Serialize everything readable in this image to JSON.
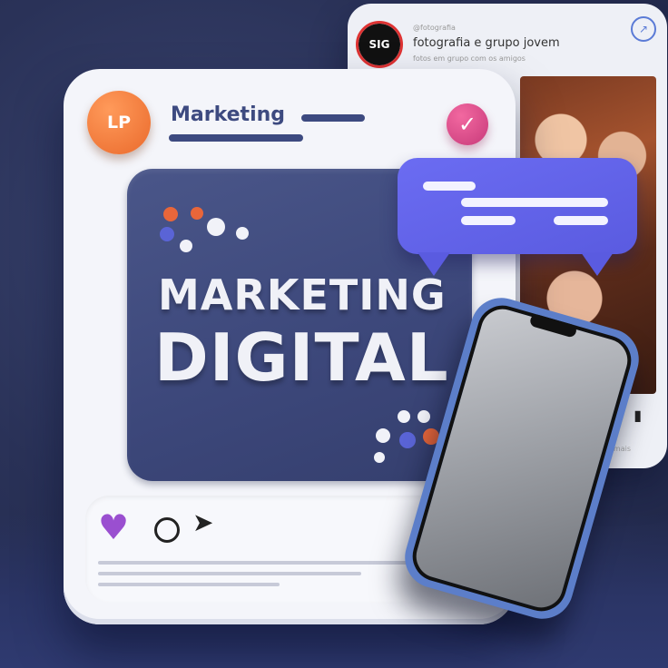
{
  "back_post": {
    "avatar_text": "SIG",
    "handle": "@fotografia",
    "title": "fotografia e grupo jovem",
    "subtitle": "fotos em grupo com os amigos",
    "share_icon": "share-icon",
    "bookmark_icon": "bookmark-icon",
    "caption": "ver mais"
  },
  "card": {
    "avatar_initials": "LP",
    "header_title": "Marketing",
    "check_icon": "check-icon",
    "headline_line1": "MARKETING",
    "headline_line2": "DIGITAL"
  },
  "actions": {
    "like_icon": "heart-icon",
    "comment_icon": "comment-icon",
    "share_icon": "send-icon"
  },
  "colors": {
    "background": "#2a3258",
    "accent_orange": "#ea6a2c",
    "accent_pink": "#c83a7a",
    "bubble_blue": "#5a5be0",
    "heart_purple": "#9a4fd0",
    "panel_navy": "#3c477a"
  }
}
